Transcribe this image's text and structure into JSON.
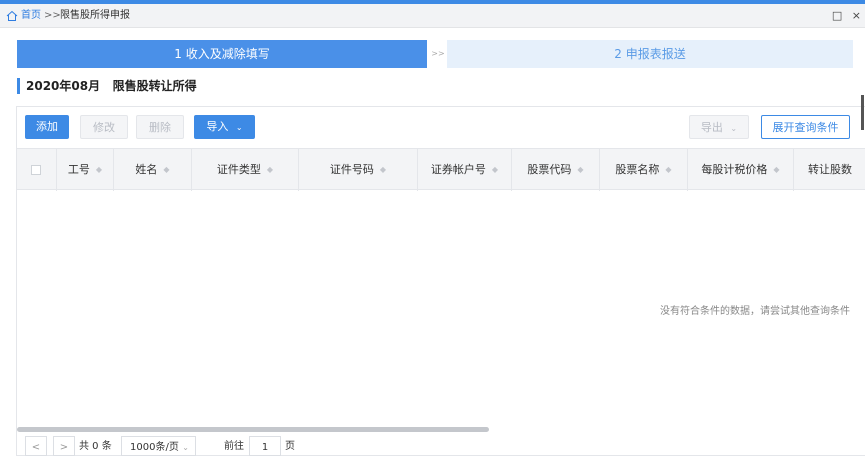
{
  "breadcrumb": {
    "home": "首页",
    "separator": ">>",
    "current": "限售股所得申报",
    "window_buttons": [
      "□",
      "×"
    ]
  },
  "steps": {
    "step1": "1 收入及减除填写",
    "separator": ">>",
    "step2": "2 申报表报送"
  },
  "section_title": "2020年08月   限售股转让所得",
  "toolbar": {
    "add": "添加",
    "edit": "修改",
    "delete": "删除",
    "import": "导入",
    "export": "导出",
    "expand_query": "展开查询条件"
  },
  "table": {
    "columns": [
      "工号",
      "姓名",
      "证件类型",
      "证件号码",
      "证券帐户号",
      "股票代码",
      "股票名称",
      "每股计税价格",
      "转让股数"
    ],
    "rows": [],
    "empty_text": "没有符合条件的数据，请尝试其他查询条件"
  },
  "pagination": {
    "prev": "<",
    "next": ">",
    "total": "共 0 条",
    "page_size": "1000条/页",
    "goto_label": "前往",
    "current_page": "1",
    "page_unit": "页"
  },
  "colors": {
    "primary": "#3d8ae5",
    "step_inactive_bg": "#e6f0fb"
  }
}
